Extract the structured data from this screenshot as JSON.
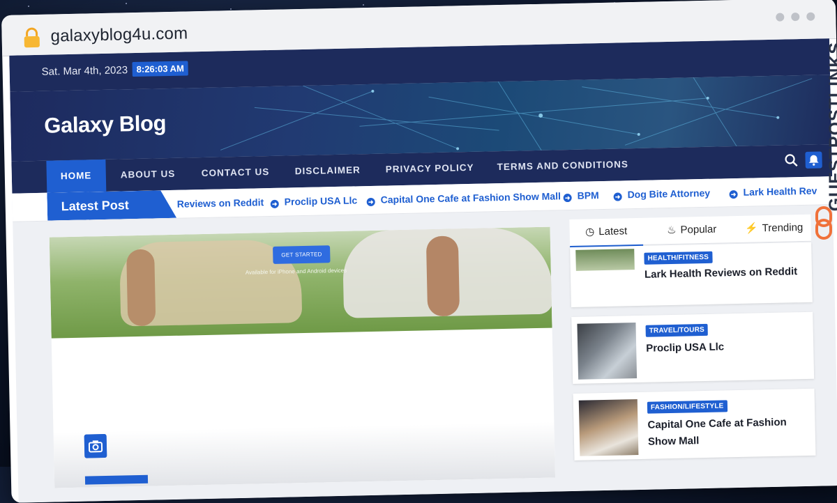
{
  "browser": {
    "url": "galaxyblog4u.com"
  },
  "topbar": {
    "date": "Sat. Mar 4th, 2023",
    "time": "8:26:03 AM"
  },
  "site": {
    "title": "Galaxy Blog"
  },
  "nav": {
    "items": [
      "HOME",
      "ABOUT US",
      "CONTACT US",
      "DISCLAIMER",
      "PRIVACY POLICY",
      "TERMS AND CONDITIONS"
    ],
    "active": "HOME"
  },
  "ticker": {
    "label": "Latest Post",
    "items": [
      "Reviews on Reddit",
      "Proclip USA Llc",
      "Capital One Cafe at Fashion Show Mall",
      "BPM",
      "Dog Bite Attorney",
      "Lark Health Rev"
    ]
  },
  "feature": {
    "cta": "GET STARTED",
    "cta_sub": "Available for iPhone and Android devices"
  },
  "sidebar": {
    "tabs": [
      "Latest",
      "Popular",
      "Trending"
    ],
    "active_tab": "Latest",
    "posts": [
      {
        "category": "HEALTH/FITNESS",
        "title": "Lark Health Reviews on Reddit"
      },
      {
        "category": "TRAVEL/TOURS",
        "title": "Proclip USA Llc"
      },
      {
        "category": "FASHION/LIFESTYLE",
        "title": "Capital One Cafe at Fashion Show Mall"
      }
    ]
  },
  "watermark": {
    "text": "GUESTPOSTLINKS"
  },
  "colors": {
    "navy": "#1d2b5c",
    "accent": "#1f5fd1",
    "watermark_logo": "#f0713a"
  }
}
